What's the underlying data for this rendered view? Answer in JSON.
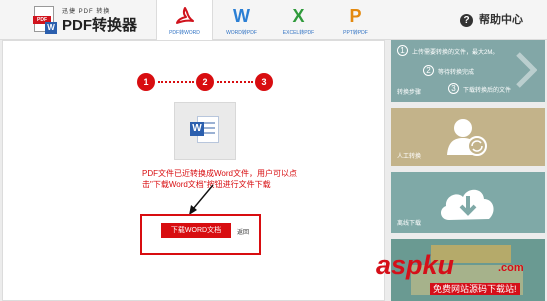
{
  "app": {
    "logo_small": "迅捷 PDF 转换",
    "logo_title": "PDF转换器",
    "logo_badge": "PDF",
    "logo_w": "W"
  },
  "tabs": [
    {
      "label": "PDF转WORD",
      "icon": "pdf-icon",
      "color": "#d0131d"
    },
    {
      "label": "WORD转PDF",
      "icon": "word-icon",
      "glyph": "W",
      "color": "#2b7fd4"
    },
    {
      "label": "EXCEL转PDF",
      "icon": "excel-icon",
      "glyph": "X",
      "color": "#2f9a3b"
    },
    {
      "label": "PPT转PDF",
      "icon": "ppt-icon",
      "glyph": "P",
      "color": "#e3890f"
    }
  ],
  "help": {
    "icon": "?",
    "label": "帮助中心"
  },
  "steps": [
    "1",
    "2",
    "3"
  ],
  "doc_icon": {
    "badge": "W"
  },
  "message": "PDF文件已近转换成Word文件，用户可以点击\"下载Word文档\"按钮进行文件下载",
  "download_button": "下载WORD文档",
  "back_link": "返回",
  "sidebar": {
    "steps_card": {
      "label": "转换步骤",
      "items": [
        {
          "num": "1",
          "text": "上传需要转换的文件，最大2M。"
        },
        {
          "num": "2",
          "text": "等待转换完成"
        },
        {
          "num": "3",
          "text": "下载转换后的文件"
        }
      ]
    },
    "manual_card": {
      "label": "人工转换"
    },
    "offline_card": {
      "label": "离线下载"
    }
  },
  "watermark": {
    "main": "aspku",
    "suffix": ".com",
    "sub": "免费网站源码下载站!"
  },
  "colors": {
    "accent": "#d80d10",
    "link_blue": "#3173c4"
  }
}
